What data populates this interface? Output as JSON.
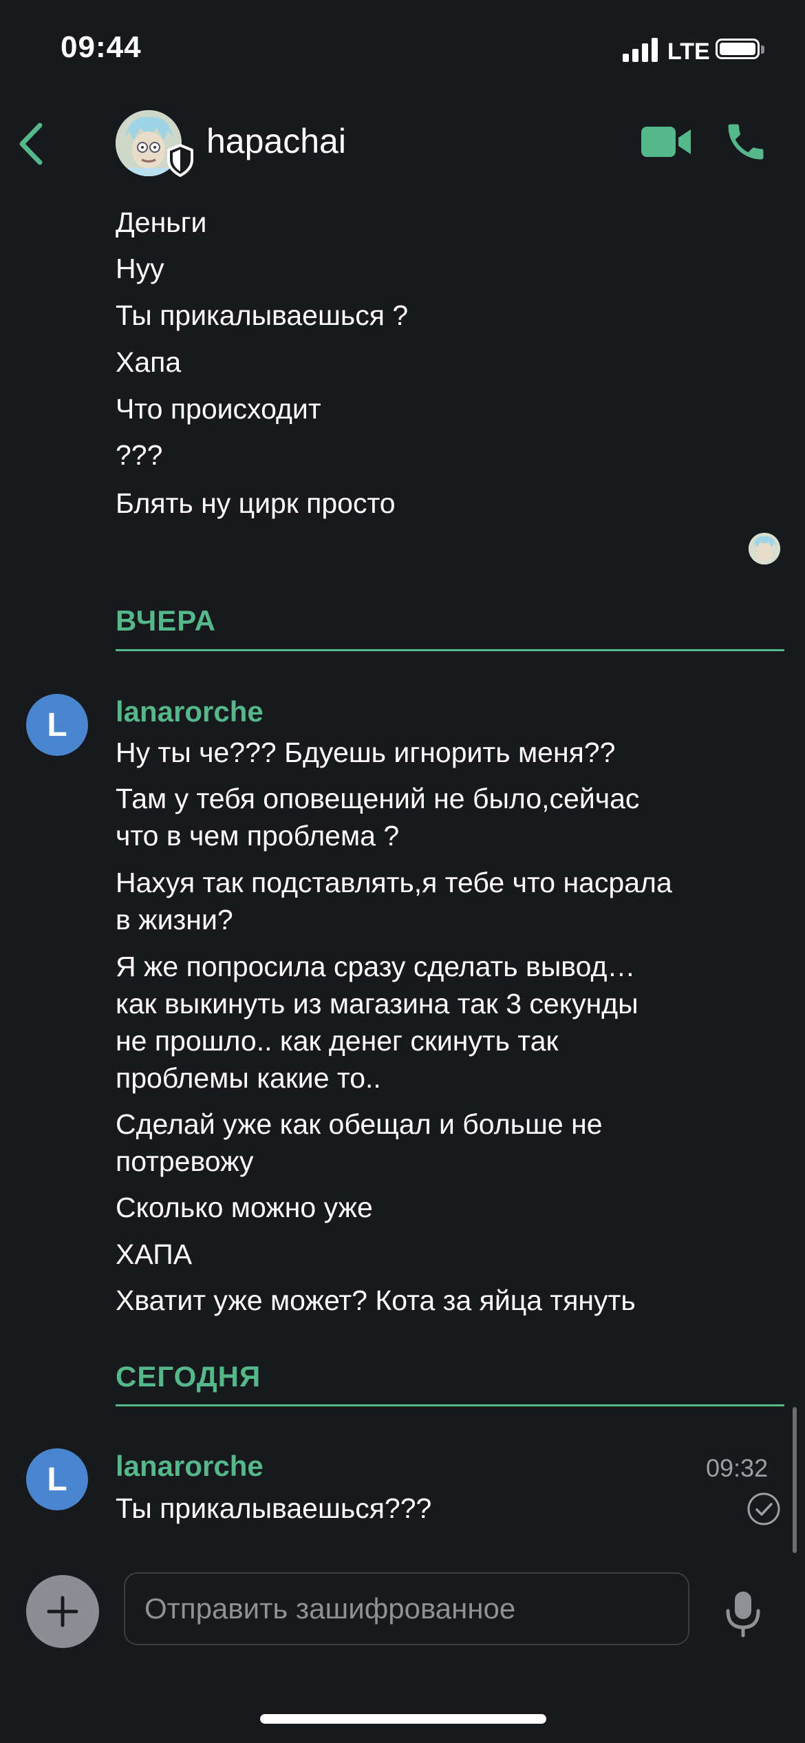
{
  "status_bar": {
    "time": "09:44",
    "network": "LTE"
  },
  "header": {
    "title": "hapachai"
  },
  "colors": {
    "accent": "#55b88a",
    "background": "#17191d",
    "avatar": "#4a86d0"
  },
  "earlier_messages": [
    "Деньги",
    "Нуу",
    "Ты прикалываешься ?",
    "Хапа",
    "Что происходит",
    "???",
    "Блять ну цирк просто"
  ],
  "day_yesterday": "ВЧЕРА",
  "group_yesterday": {
    "avatar_letter": "L",
    "sender": "lanarorche",
    "messages": [
      "Ну ты че??? Бдуешь игнорить меня??",
      "Там у тебя оповещений не было,сейчас\nчто в чем проблема ?",
      "Нахуя так подставлять,я тебе что насрала\nв жизни?",
      "Я же попросила сразу сделать вывод…\nкак выкинуть из магазина так 3 секунды\nне прошло.. как денег скинуть так\nпроблемы какие то..",
      "Сделай уже как обещал и больше не\nпотревожу",
      "Сколько можно уже",
      "ХАПА",
      "Хватит уже может? Кота за яйца тянуть"
    ]
  },
  "day_today": "СЕГОДНЯ",
  "group_today": {
    "avatar_letter": "L",
    "sender": "lanarorche",
    "time": "09:32",
    "message": "Ты прикалываешься???"
  },
  "composer": {
    "placeholder": "Отправить зашифрованное"
  },
  "icons": [
    "back-chevron-icon",
    "shield-icon",
    "video-call-icon",
    "phone-call-icon",
    "plus-icon",
    "microphone-icon",
    "read-check-icon"
  ]
}
